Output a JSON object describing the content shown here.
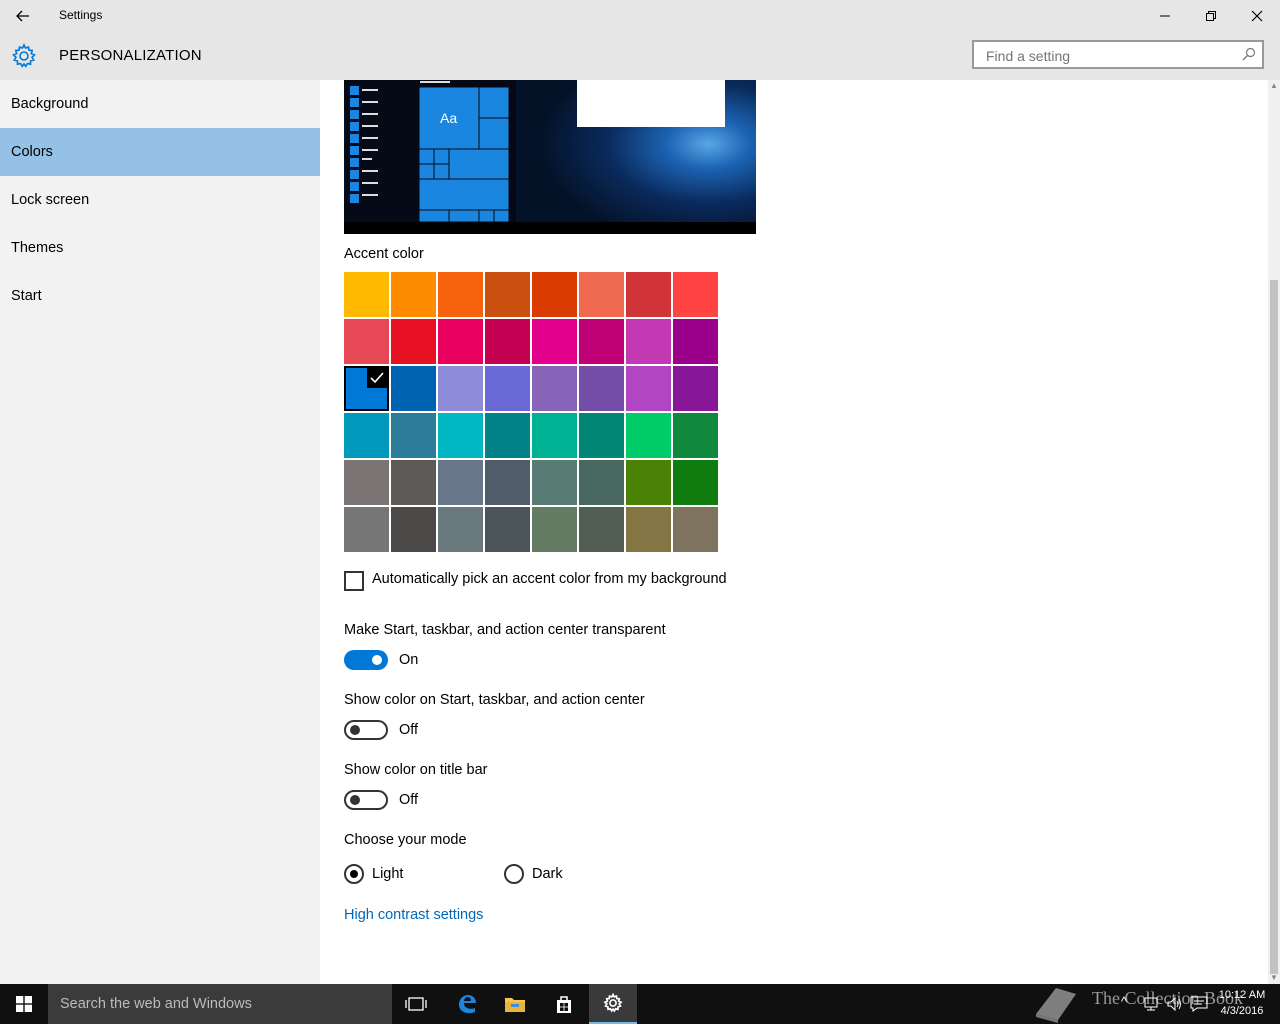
{
  "window": {
    "title": "Settings",
    "back_glyph": "←",
    "minimize_glyph": "—",
    "close_glyph": "✕"
  },
  "header": {
    "page_title": "PERSONALIZATION",
    "search_placeholder": "Find a setting"
  },
  "sidebar": {
    "items": [
      {
        "label": "Background",
        "active": false
      },
      {
        "label": "Colors",
        "active": true
      },
      {
        "label": "Lock screen",
        "active": false
      },
      {
        "label": "Themes",
        "active": false
      },
      {
        "label": "Start",
        "active": false
      }
    ]
  },
  "preview": {
    "tile_text": "Aa"
  },
  "accent": {
    "label": "Accent color",
    "selected_index": 16,
    "colors": [
      "#FFB900",
      "#FF8C00",
      "#F7630C",
      "#CA5010",
      "#DA3B01",
      "#EF6950",
      "#D13438",
      "#FF4343",
      "#E74856",
      "#E81123",
      "#EA005E",
      "#C30052",
      "#E3008C",
      "#BF0077",
      "#C239B3",
      "#9A0089",
      "#0078D7",
      "#0063B1",
      "#8E8CD8",
      "#6B69D6",
      "#8764B8",
      "#744DA9",
      "#B146C2",
      "#881798",
      "#0099BC",
      "#2D7D9A",
      "#00B7C3",
      "#038387",
      "#00B294",
      "#018574",
      "#00CC6A",
      "#10893E",
      "#7A7574",
      "#5D5A58",
      "#68768A",
      "#515C6B",
      "#567C73",
      "#486860",
      "#498205",
      "#107C10",
      "#767676",
      "#4C4A48",
      "#69797E",
      "#4A5459",
      "#647C64",
      "#525E54",
      "#847545",
      "#7E735F"
    ]
  },
  "auto_pick": {
    "label": "Automatically pick an accent color from my background",
    "checked": false
  },
  "toggles": {
    "transparent": {
      "label": "Make Start, taskbar, and action center transparent",
      "state": "On"
    },
    "show_color_start": {
      "label": "Show color on Start, taskbar, and action center",
      "state": "Off"
    },
    "show_color_title": {
      "label": "Show color on title bar",
      "state": "Off"
    }
  },
  "mode": {
    "label": "Choose your mode",
    "options": [
      {
        "label": "Light",
        "selected": true
      },
      {
        "label": "Dark",
        "selected": false
      }
    ]
  },
  "links": {
    "high_contrast": "High contrast settings"
  },
  "taskbar": {
    "search_text": "Search the web and Windows",
    "watermark": "The Collection Book",
    "time": "10:12 AM",
    "date": "4/3/2016",
    "tray_chevron": "^"
  },
  "colors": {
    "accent": "#0078d7",
    "selected_nav": "#96c1e6",
    "link": "#0067b8"
  }
}
